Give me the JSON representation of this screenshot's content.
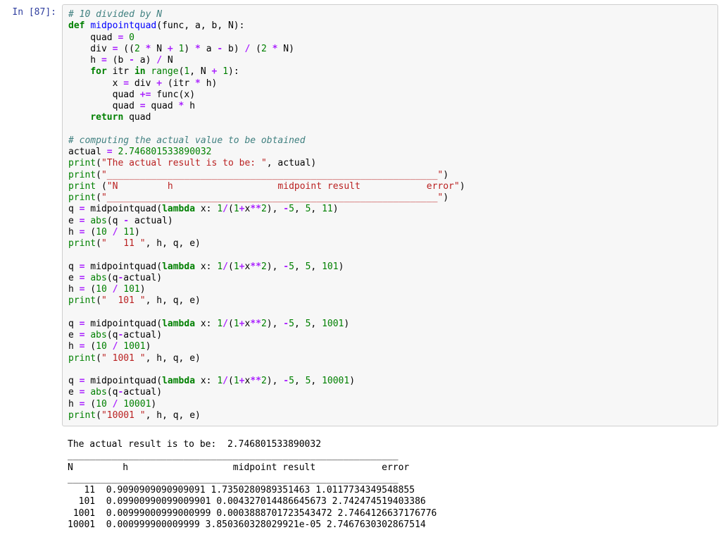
{
  "prompt_label": "In [87]:",
  "code_lines": [
    [
      {
        "t": "# 10 divided by N",
        "c": "c-comment"
      }
    ],
    [
      {
        "t": "def ",
        "c": "c-keyword"
      },
      {
        "t": "midpointquad",
        "c": "c-def"
      },
      {
        "t": "(func, a, b, N):",
        "c": ""
      }
    ],
    [
      {
        "t": "    quad ",
        "c": ""
      },
      {
        "t": "=",
        "c": "c-op"
      },
      {
        "t": " ",
        "c": ""
      },
      {
        "t": "0",
        "c": "c-num"
      }
    ],
    [
      {
        "t": "    div ",
        "c": ""
      },
      {
        "t": "=",
        "c": "c-op"
      },
      {
        "t": " ((",
        "c": ""
      },
      {
        "t": "2",
        "c": "c-num"
      },
      {
        "t": " ",
        "c": ""
      },
      {
        "t": "*",
        "c": "c-op"
      },
      {
        "t": " N ",
        "c": ""
      },
      {
        "t": "+",
        "c": "c-op"
      },
      {
        "t": " ",
        "c": ""
      },
      {
        "t": "1",
        "c": "c-num"
      },
      {
        "t": ") ",
        "c": ""
      },
      {
        "t": "*",
        "c": "c-op"
      },
      {
        "t": " a ",
        "c": ""
      },
      {
        "t": "-",
        "c": "c-op"
      },
      {
        "t": " b) ",
        "c": ""
      },
      {
        "t": "/",
        "c": "c-op"
      },
      {
        "t": " (",
        "c": ""
      },
      {
        "t": "2",
        "c": "c-num"
      },
      {
        "t": " ",
        "c": ""
      },
      {
        "t": "*",
        "c": "c-op"
      },
      {
        "t": " N)",
        "c": ""
      }
    ],
    [
      {
        "t": "    h ",
        "c": ""
      },
      {
        "t": "=",
        "c": "c-op"
      },
      {
        "t": " (b ",
        "c": ""
      },
      {
        "t": "-",
        "c": "c-op"
      },
      {
        "t": " a) ",
        "c": ""
      },
      {
        "t": "/",
        "c": "c-op"
      },
      {
        "t": " N",
        "c": ""
      }
    ],
    [
      {
        "t": "    ",
        "c": ""
      },
      {
        "t": "for",
        "c": "c-keyword"
      },
      {
        "t": " itr ",
        "c": ""
      },
      {
        "t": "in",
        "c": "c-keyword"
      },
      {
        "t": " ",
        "c": ""
      },
      {
        "t": "range",
        "c": "c-builtin"
      },
      {
        "t": "(",
        "c": ""
      },
      {
        "t": "1",
        "c": "c-num"
      },
      {
        "t": ", N ",
        "c": ""
      },
      {
        "t": "+",
        "c": "c-op"
      },
      {
        "t": " ",
        "c": ""
      },
      {
        "t": "1",
        "c": "c-num"
      },
      {
        "t": "):",
        "c": ""
      }
    ],
    [
      {
        "t": "        x ",
        "c": ""
      },
      {
        "t": "=",
        "c": "c-op"
      },
      {
        "t": " div ",
        "c": ""
      },
      {
        "t": "+",
        "c": "c-op"
      },
      {
        "t": " (itr ",
        "c": ""
      },
      {
        "t": "*",
        "c": "c-op"
      },
      {
        "t": " h)",
        "c": ""
      }
    ],
    [
      {
        "t": "        quad ",
        "c": ""
      },
      {
        "t": "+=",
        "c": "c-op"
      },
      {
        "t": " func(x)",
        "c": ""
      }
    ],
    [
      {
        "t": "        quad ",
        "c": ""
      },
      {
        "t": "=",
        "c": "c-op"
      },
      {
        "t": " quad ",
        "c": ""
      },
      {
        "t": "*",
        "c": "c-op"
      },
      {
        "t": " h",
        "c": ""
      }
    ],
    [
      {
        "t": "    ",
        "c": ""
      },
      {
        "t": "return",
        "c": "c-keyword"
      },
      {
        "t": " quad",
        "c": ""
      }
    ],
    [
      {
        "t": "",
        "c": ""
      }
    ],
    [
      {
        "t": "# computing the actual value to be obtained",
        "c": "c-comment"
      }
    ],
    [
      {
        "t": "actual ",
        "c": ""
      },
      {
        "t": "=",
        "c": "c-op"
      },
      {
        "t": " ",
        "c": ""
      },
      {
        "t": "2.746801533890032",
        "c": "c-num"
      }
    ],
    [
      {
        "t": "print",
        "c": "c-builtin"
      },
      {
        "t": "(",
        "c": ""
      },
      {
        "t": "\"The actual result is to be: \"",
        "c": "c-str"
      },
      {
        "t": ", actual)",
        "c": ""
      }
    ],
    [
      {
        "t": "print",
        "c": "c-builtin"
      },
      {
        "t": "(",
        "c": ""
      },
      {
        "t": "\"____________________________________________________________\"",
        "c": "c-str"
      },
      {
        "t": ")",
        "c": ""
      }
    ],
    [
      {
        "t": "print",
        "c": "c-builtin"
      },
      {
        "t": " (",
        "c": ""
      },
      {
        "t": "\"N         h                   midpoint result            error\"",
        "c": "c-str"
      },
      {
        "t": ")",
        "c": ""
      }
    ],
    [
      {
        "t": "print",
        "c": "c-builtin"
      },
      {
        "t": "(",
        "c": ""
      },
      {
        "t": "\"____________________________________________________________\"",
        "c": "c-str"
      },
      {
        "t": ")",
        "c": ""
      }
    ],
    [
      {
        "t": "q ",
        "c": ""
      },
      {
        "t": "=",
        "c": "c-op"
      },
      {
        "t": " midpointquad(",
        "c": ""
      },
      {
        "t": "lambda",
        "c": "c-keyword"
      },
      {
        "t": " x: ",
        "c": ""
      },
      {
        "t": "1",
        "c": "c-num"
      },
      {
        "t": "/",
        "c": "c-op"
      },
      {
        "t": "(",
        "c": ""
      },
      {
        "t": "1",
        "c": "c-num"
      },
      {
        "t": "+",
        "c": "c-op"
      },
      {
        "t": "x",
        "c": ""
      },
      {
        "t": "**",
        "c": "c-op"
      },
      {
        "t": "2",
        "c": "c-num"
      },
      {
        "t": "), ",
        "c": ""
      },
      {
        "t": "-",
        "c": "c-op"
      },
      {
        "t": "5",
        "c": "c-num"
      },
      {
        "t": ", ",
        "c": ""
      },
      {
        "t": "5",
        "c": "c-num"
      },
      {
        "t": ", ",
        "c": ""
      },
      {
        "t": "11",
        "c": "c-num"
      },
      {
        "t": ")",
        "c": ""
      }
    ],
    [
      {
        "t": "e ",
        "c": ""
      },
      {
        "t": "=",
        "c": "c-op"
      },
      {
        "t": " ",
        "c": ""
      },
      {
        "t": "abs",
        "c": "c-builtin"
      },
      {
        "t": "(q ",
        "c": ""
      },
      {
        "t": "-",
        "c": "c-op"
      },
      {
        "t": " actual)",
        "c": ""
      }
    ],
    [
      {
        "t": "h ",
        "c": ""
      },
      {
        "t": "=",
        "c": "c-op"
      },
      {
        "t": " (",
        "c": ""
      },
      {
        "t": "10",
        "c": "c-num"
      },
      {
        "t": " ",
        "c": ""
      },
      {
        "t": "/",
        "c": "c-op"
      },
      {
        "t": " ",
        "c": ""
      },
      {
        "t": "11",
        "c": "c-num"
      },
      {
        "t": ")",
        "c": ""
      }
    ],
    [
      {
        "t": "print",
        "c": "c-builtin"
      },
      {
        "t": "(",
        "c": ""
      },
      {
        "t": "\"   11 \"",
        "c": "c-str"
      },
      {
        "t": ", h, q, e)",
        "c": ""
      }
    ],
    [
      {
        "t": "",
        "c": ""
      }
    ],
    [
      {
        "t": "q ",
        "c": ""
      },
      {
        "t": "=",
        "c": "c-op"
      },
      {
        "t": " midpointquad(",
        "c": ""
      },
      {
        "t": "lambda",
        "c": "c-keyword"
      },
      {
        "t": " x: ",
        "c": ""
      },
      {
        "t": "1",
        "c": "c-num"
      },
      {
        "t": "/",
        "c": "c-op"
      },
      {
        "t": "(",
        "c": ""
      },
      {
        "t": "1",
        "c": "c-num"
      },
      {
        "t": "+",
        "c": "c-op"
      },
      {
        "t": "x",
        "c": ""
      },
      {
        "t": "**",
        "c": "c-op"
      },
      {
        "t": "2",
        "c": "c-num"
      },
      {
        "t": "), ",
        "c": ""
      },
      {
        "t": "-",
        "c": "c-op"
      },
      {
        "t": "5",
        "c": "c-num"
      },
      {
        "t": ", ",
        "c": ""
      },
      {
        "t": "5",
        "c": "c-num"
      },
      {
        "t": ", ",
        "c": ""
      },
      {
        "t": "101",
        "c": "c-num"
      },
      {
        "t": ")",
        "c": ""
      }
    ],
    [
      {
        "t": "e ",
        "c": ""
      },
      {
        "t": "=",
        "c": "c-op"
      },
      {
        "t": " ",
        "c": ""
      },
      {
        "t": "abs",
        "c": "c-builtin"
      },
      {
        "t": "(q",
        "c": ""
      },
      {
        "t": "-",
        "c": "c-op"
      },
      {
        "t": "actual)",
        "c": ""
      }
    ],
    [
      {
        "t": "h ",
        "c": ""
      },
      {
        "t": "=",
        "c": "c-op"
      },
      {
        "t": " (",
        "c": ""
      },
      {
        "t": "10",
        "c": "c-num"
      },
      {
        "t": " ",
        "c": ""
      },
      {
        "t": "/",
        "c": "c-op"
      },
      {
        "t": " ",
        "c": ""
      },
      {
        "t": "101",
        "c": "c-num"
      },
      {
        "t": ")",
        "c": ""
      }
    ],
    [
      {
        "t": "print",
        "c": "c-builtin"
      },
      {
        "t": "(",
        "c": ""
      },
      {
        "t": "\"  101 \"",
        "c": "c-str"
      },
      {
        "t": ", h, q, e)",
        "c": ""
      }
    ],
    [
      {
        "t": "",
        "c": ""
      }
    ],
    [
      {
        "t": "q ",
        "c": ""
      },
      {
        "t": "=",
        "c": "c-op"
      },
      {
        "t": " midpointquad(",
        "c": ""
      },
      {
        "t": "lambda",
        "c": "c-keyword"
      },
      {
        "t": " x: ",
        "c": ""
      },
      {
        "t": "1",
        "c": "c-num"
      },
      {
        "t": "/",
        "c": "c-op"
      },
      {
        "t": "(",
        "c": ""
      },
      {
        "t": "1",
        "c": "c-num"
      },
      {
        "t": "+",
        "c": "c-op"
      },
      {
        "t": "x",
        "c": ""
      },
      {
        "t": "**",
        "c": "c-op"
      },
      {
        "t": "2",
        "c": "c-num"
      },
      {
        "t": "), ",
        "c": ""
      },
      {
        "t": "-",
        "c": "c-op"
      },
      {
        "t": "5",
        "c": "c-num"
      },
      {
        "t": ", ",
        "c": ""
      },
      {
        "t": "5",
        "c": "c-num"
      },
      {
        "t": ", ",
        "c": ""
      },
      {
        "t": "1001",
        "c": "c-num"
      },
      {
        "t": ")",
        "c": ""
      }
    ],
    [
      {
        "t": "e ",
        "c": ""
      },
      {
        "t": "=",
        "c": "c-op"
      },
      {
        "t": " ",
        "c": ""
      },
      {
        "t": "abs",
        "c": "c-builtin"
      },
      {
        "t": "(q",
        "c": ""
      },
      {
        "t": "-",
        "c": "c-op"
      },
      {
        "t": "actual)",
        "c": ""
      }
    ],
    [
      {
        "t": "h ",
        "c": ""
      },
      {
        "t": "=",
        "c": "c-op"
      },
      {
        "t": " (",
        "c": ""
      },
      {
        "t": "10",
        "c": "c-num"
      },
      {
        "t": " ",
        "c": ""
      },
      {
        "t": "/",
        "c": "c-op"
      },
      {
        "t": " ",
        "c": ""
      },
      {
        "t": "1001",
        "c": "c-num"
      },
      {
        "t": ")",
        "c": ""
      }
    ],
    [
      {
        "t": "print",
        "c": "c-builtin"
      },
      {
        "t": "(",
        "c": ""
      },
      {
        "t": "\" 1001 \"",
        "c": "c-str"
      },
      {
        "t": ", h, q, e)",
        "c": ""
      }
    ],
    [
      {
        "t": "",
        "c": ""
      }
    ],
    [
      {
        "t": "q ",
        "c": ""
      },
      {
        "t": "=",
        "c": "c-op"
      },
      {
        "t": " midpointquad(",
        "c": ""
      },
      {
        "t": "lambda",
        "c": "c-keyword"
      },
      {
        "t": " x: ",
        "c": ""
      },
      {
        "t": "1",
        "c": "c-num"
      },
      {
        "t": "/",
        "c": "c-op"
      },
      {
        "t": "(",
        "c": ""
      },
      {
        "t": "1",
        "c": "c-num"
      },
      {
        "t": "+",
        "c": "c-op"
      },
      {
        "t": "x",
        "c": ""
      },
      {
        "t": "**",
        "c": "c-op"
      },
      {
        "t": "2",
        "c": "c-num"
      },
      {
        "t": "), ",
        "c": ""
      },
      {
        "t": "-",
        "c": "c-op"
      },
      {
        "t": "5",
        "c": "c-num"
      },
      {
        "t": ", ",
        "c": ""
      },
      {
        "t": "5",
        "c": "c-num"
      },
      {
        "t": ", ",
        "c": ""
      },
      {
        "t": "10001",
        "c": "c-num"
      },
      {
        "t": ")",
        "c": ""
      }
    ],
    [
      {
        "t": "e ",
        "c": ""
      },
      {
        "t": "=",
        "c": "c-op"
      },
      {
        "t": " ",
        "c": ""
      },
      {
        "t": "abs",
        "c": "c-builtin"
      },
      {
        "t": "(q",
        "c": ""
      },
      {
        "t": "-",
        "c": "c-op"
      },
      {
        "t": "actual)",
        "c": ""
      }
    ],
    [
      {
        "t": "h ",
        "c": ""
      },
      {
        "t": "=",
        "c": "c-op"
      },
      {
        "t": " (",
        "c": ""
      },
      {
        "t": "10",
        "c": "c-num"
      },
      {
        "t": " ",
        "c": ""
      },
      {
        "t": "/",
        "c": "c-op"
      },
      {
        "t": " ",
        "c": ""
      },
      {
        "t": "10001",
        "c": "c-num"
      },
      {
        "t": ")",
        "c": ""
      }
    ],
    [
      {
        "t": "print",
        "c": "c-builtin"
      },
      {
        "t": "(",
        "c": ""
      },
      {
        "t": "\"10001 \"",
        "c": "c-str"
      },
      {
        "t": ", h, q, e)",
        "c": ""
      }
    ]
  ],
  "output_lines": [
    "The actual result is to be:  2.746801533890032",
    "____________________________________________________________",
    "N         h                   midpoint result            error",
    "____________________________________________________________",
    "   11  0.9090909090909091 1.7350280989351463 1.0117734349548855",
    "  101  0.09900990099009901 0.004327014486645673 2.742474519403386",
    " 1001  0.00999000999000999 0.0003888701723543472 2.7464126637176776",
    "10001  0.000999900009999 3.850360328029921e-05 2.7467630302867514"
  ]
}
